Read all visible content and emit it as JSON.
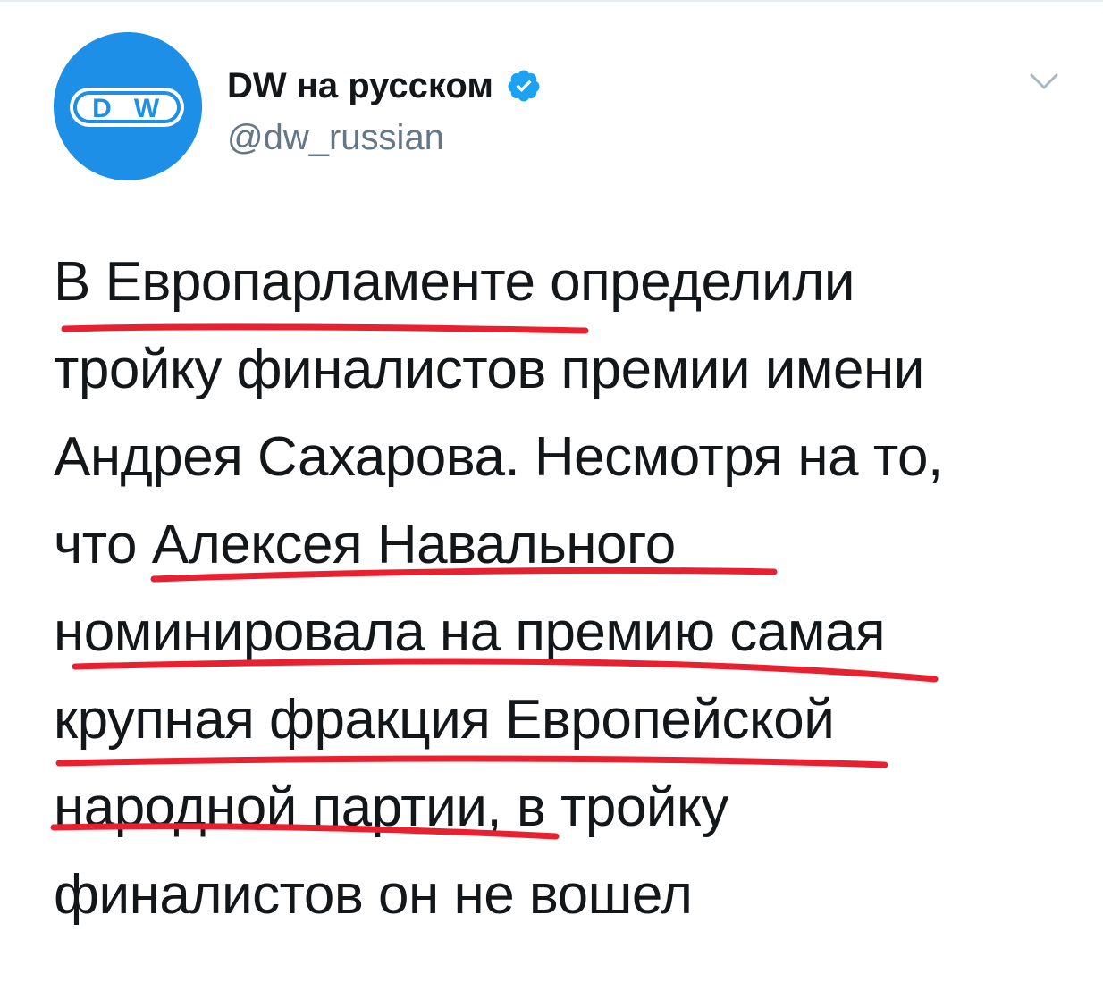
{
  "tweet": {
    "author": {
      "name": "DW на русском",
      "handle": "@dw_russian",
      "avatar_logo": "DW",
      "avatar_color": "#1d8fe6",
      "verified": true,
      "verified_icon": "verified-check-icon",
      "menu_icon": "chevron-down-icon"
    },
    "text_lines": [
      "В Европарламенте определили",
      "тройку финалистов премии имени",
      "Андрея Сахарова. Несмотря на то,",
      "что Алексея Навального",
      "номинировала на премию самая",
      "крупная фракция Европейской",
      "народной партии, в тройку",
      "финалистов он не вошел"
    ]
  },
  "annotations": {
    "underline_color": "#e8202f",
    "underlined_phrases": [
      "Европарламенте",
      "Алексея Навального",
      "номинировала на премию самая",
      "крупная фракция Европейской",
      "народной партии"
    ]
  }
}
